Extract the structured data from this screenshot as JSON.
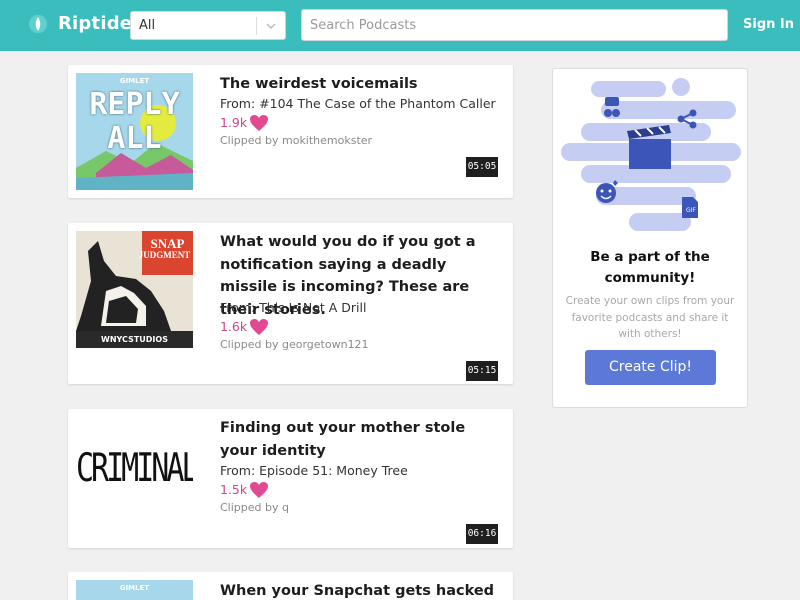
{
  "header": {
    "app_name": "Riptide",
    "category_value": "All",
    "search_placeholder": "Search Podcasts",
    "signin_label": "Sign In",
    "brand_color": "#3cbdbd"
  },
  "clips": [
    {
      "title": "The weirdest voicemails",
      "from": "From: #104 The Case of the Phantom Caller",
      "likes": "1.9k",
      "clipped_by": "Clipped by mokithemokster",
      "duration": "05:05",
      "art": {
        "top_label": "GIMLET",
        "title_line1": "REPLY",
        "title_line2": "ALL"
      }
    },
    {
      "title": "What would you do if you got a notification saying a deadly missile is incoming? These are their stories.",
      "from": "From: This Is Not A Drill",
      "likes": "1.6k",
      "clipped_by": "Clipped by georgetown121",
      "duration": "05:15",
      "art": {
        "title_line1": "SNAP",
        "title_line2": "JUDGMENT",
        "footer": "WNYCSTUDIOS"
      }
    },
    {
      "title": "Finding out your mother stole your identity",
      "from": "From: Episode 51: Money Tree",
      "likes": "1.5k",
      "clipped_by": "Clipped by q",
      "duration": "06:16",
      "art": {
        "title_line1": "CRIMINAL"
      }
    },
    {
      "title": "When your Snapchat gets hacked",
      "art": {
        "top_label": "GIMLET"
      }
    }
  ],
  "sidebar": {
    "title": "Be a part of the community!",
    "description": "Create your own clips from your favorite podcasts and share it with others!",
    "button_label": "Create Clip!",
    "button_color": "#5d79d8"
  }
}
